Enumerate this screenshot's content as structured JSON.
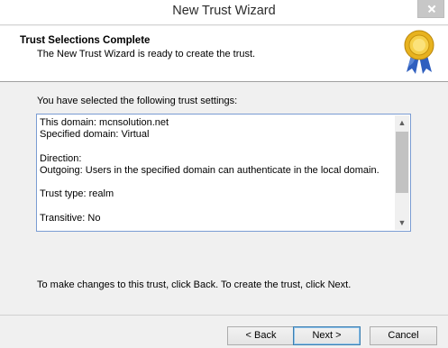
{
  "window": {
    "title": "New Trust Wizard",
    "close_icon": "close-icon"
  },
  "header": {
    "title": "Trust Selections Complete",
    "subtitle": "The New Trust Wizard is ready to create the trust.",
    "icon": "medal-icon",
    "icon_colors": {
      "medal": "#e7b21f",
      "ribbon": "#2f5fbf"
    }
  },
  "main": {
    "intro": "You have selected the following trust settings:",
    "settings_lines": [
      "This domain: mcnsolution.net",
      "Specified domain: Virtual",
      "",
      "Direction:",
      "Outgoing: Users in the specified domain can authenticate in the local domain.",
      "",
      "Trust type: realm",
      "",
      "Transitive: No"
    ],
    "footer_note": "To make changes to this trust, click Back. To create the trust, click Next."
  },
  "buttons": {
    "back": "< Back",
    "next": "Next >",
    "cancel": "Cancel"
  }
}
